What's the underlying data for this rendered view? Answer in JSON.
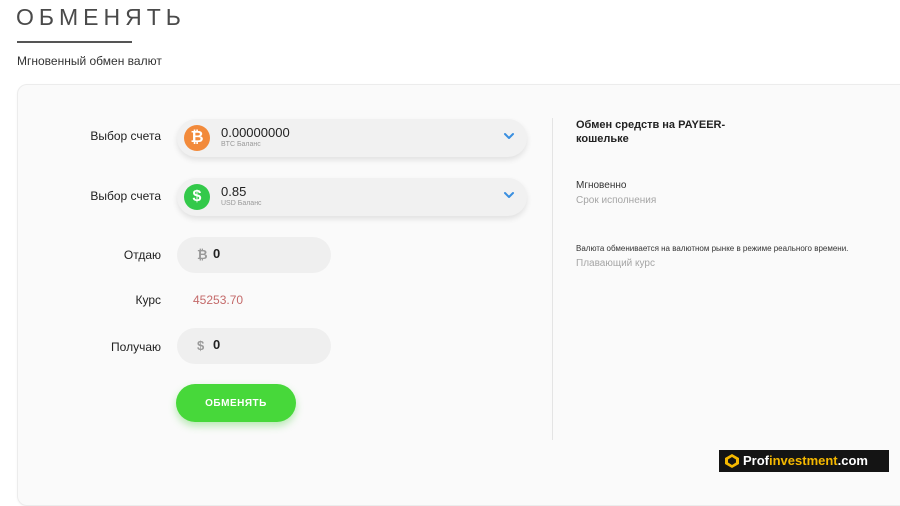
{
  "header": {
    "title": "ОБМЕНЯТЬ",
    "subtitle": "Мгновенный обмен валют"
  },
  "form": {
    "account_label_1": "Выбор счета",
    "account_label_2": "Выбор счета",
    "select_1": {
      "value": "0.00000000",
      "sub": "BTC Баланс",
      "icon": "bitcoin-icon",
      "symbol": "₿"
    },
    "select_2": {
      "value": "0.85",
      "sub": "USD Баланс",
      "icon": "dollar-icon",
      "symbol": "$"
    },
    "give_label": "Отдаю",
    "give_currency": "₿",
    "give_value": "0",
    "rate_label": "Курс",
    "rate_value": "45253.70",
    "get_label": "Получаю",
    "get_currency": "$",
    "get_value": "0",
    "submit_label": "ОБМЕНЯТЬ"
  },
  "info": {
    "title": "Обмен средств на PAYEER-кошельке",
    "speed_value": "Мгновенно",
    "speed_label": "Срок исполнения",
    "rate_desc": "Валюта обменивается на валютном рынке в режиме реального времени.",
    "rate_type": "Плавающий курс"
  },
  "watermark": {
    "text_prefix": "Prof",
    "text_accent": "investment",
    "text_suffix": ".com"
  },
  "colors": {
    "btc": "#f28a3b",
    "usd": "#33c94a",
    "button": "#47d83a",
    "rate": "#c46a6a",
    "chevron": "#3a8fe0"
  }
}
